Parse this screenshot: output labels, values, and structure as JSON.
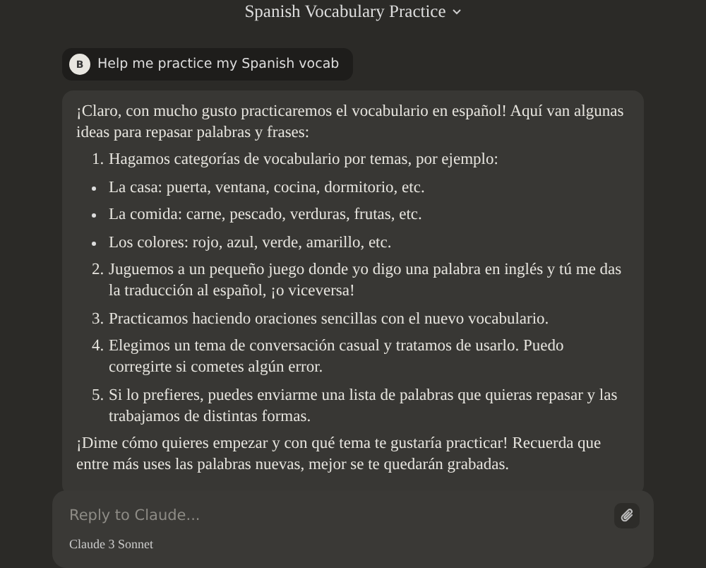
{
  "header": {
    "title": "Spanish Vocabulary Practice"
  },
  "user_message": {
    "avatar": "B",
    "text": "Help me practice my Spanish vocab"
  },
  "assistant_message": {
    "intro": "¡Claro, con mucho gusto practicaremos el vocabulario en español! Aquí van algunas ideas para repasar palabras y frases:",
    "items": [
      {
        "kind": "numbered",
        "marker": "1.",
        "text": "Hagamos categorías de vocabulario por temas, por ejemplo:"
      },
      {
        "kind": "bullet",
        "text": "La casa: puerta, ventana, cocina, dormitorio, etc."
      },
      {
        "kind": "bullet",
        "text": "La comida: carne, pescado, verduras, frutas, etc."
      },
      {
        "kind": "bullet",
        "text": "Los colores: rojo, azul, verde, amarillo, etc."
      },
      {
        "kind": "numbered",
        "marker": "2.",
        "text": "Juguemos a un pequeño juego donde yo digo una palabra en inglés y tú me das la traducción al español, ¡o viceversa!"
      },
      {
        "kind": "numbered",
        "marker": "3.",
        "text": "Practicamos haciendo oraciones sencillas con el nuevo vocabulario."
      },
      {
        "kind": "numbered",
        "marker": "4.",
        "text": "Elegimos un tema de conversación casual y tratamos de usarlo. Puedo corregirte si cometes algún error."
      },
      {
        "kind": "numbered",
        "marker": "5.",
        "text": "Si lo prefieres, puedes enviarme una lista de palabras que quieras repasar y las trabajamos de distintas formas."
      }
    ],
    "outro": "¡Dime cómo quieres empezar y con qué tema te gustaría practicar! Recuerda que entre más uses las palabras nuevas, mejor se te quedarán grabadas."
  },
  "composer": {
    "placeholder": "Reply to Claude...",
    "model": "Claude 3 Sonnet"
  }
}
